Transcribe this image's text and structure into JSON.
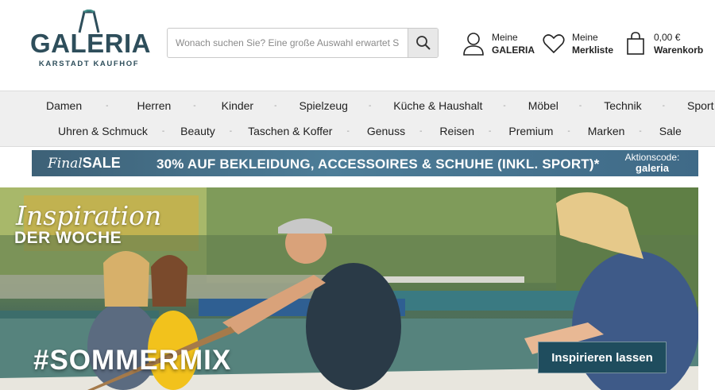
{
  "header": {
    "logo": {
      "word": "GALERIA",
      "sub": "KARSTADT KAUFHOF"
    },
    "search": {
      "placeholder": "Wonach suchen Sie? Eine große Auswahl erwartet Sie!",
      "icon": "search-icon"
    },
    "account": {
      "line1": "Meine",
      "line2": "GALERIA",
      "icon": "user-icon"
    },
    "wishlist": {
      "line1": "Meine",
      "line2": "Merkliste",
      "icon": "heart-icon"
    },
    "cart": {
      "line1": "0,00 €",
      "line2": "Warenkorb",
      "icon": "shopping-bag-icon"
    }
  },
  "nav": {
    "row1": [
      "Damen",
      "Herren",
      "Kinder",
      "Spielzeug",
      "Küche & Haushalt",
      "Möbel",
      "Technik",
      "Sport"
    ],
    "row2": [
      "Uhren & Schmuck",
      "Beauty",
      "Taschen & Koffer",
      "Genuss",
      "Reisen",
      "Premium",
      "Marken",
      "Sale"
    ],
    "separator": "-"
  },
  "sale_banner": {
    "final": "Final",
    "sale": "SALE",
    "text": "30% AUF BEKLEIDUNG, ACCESSOIRES & SCHUHE (INKL. SPORT)*",
    "code_label": "Aktionscode:",
    "code_value": "galeria"
  },
  "hero": {
    "title_script": "Inspiration",
    "title_caps": "DER WOCHE",
    "hashtag": "#SOMMERMIX",
    "cta": "Inspirieren lassen"
  },
  "colors": {
    "brand": "#2e4e5b",
    "nav_bg": "#efefef",
    "banner_bg": "#4d7d98",
    "cta_bg": "#1f4d5e"
  }
}
